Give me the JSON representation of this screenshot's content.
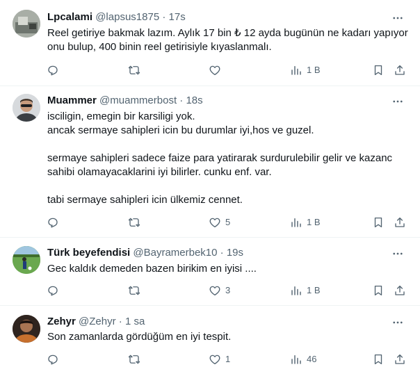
{
  "tweets": [
    {
      "name": "Lpcalami",
      "handle": "@lapsus1875",
      "dot": "·",
      "time": "17s",
      "lines": [
        "Reel getiriye bakmak lazım. Aylık 17 bin ₺ 12 ayda bugünün ne kadarı yapıyor",
        "onu bulup, 400 binin reel getirisiyle kıyaslanmalı."
      ],
      "reply_count": "",
      "retweet_count": "",
      "like_count": "",
      "view_count": "1 B"
    },
    {
      "name": "Muammer",
      "handle": "@muammerbost",
      "dot": "·",
      "time": "18s",
      "lines": [
        "isciligin, emegin bir karsiligi yok.",
        "ancak sermaye sahipleri icin bu durumlar iyi,hos ve guzel.",
        "sermaye sahipleri sadece faize para yatirarak surdurulebilir gelir ve kazanc",
        "sahibi olamayacaklarini iyi bilirler. cunku enf. var.",
        "tabi sermaye sahipleri icin ülkemiz cennet."
      ],
      "reply_count": "",
      "retweet_count": "",
      "like_count": "5",
      "view_count": "1 B"
    },
    {
      "name": "Türk beyefendisi",
      "handle": "@Bayramerbek10",
      "dot": "·",
      "time": "19s",
      "lines": [
        "Gec kaldık demeden bazen birikim en iyisi ...."
      ],
      "reply_count": "",
      "retweet_count": "",
      "like_count": "3",
      "view_count": "1 B"
    },
    {
      "name": "Zehyr",
      "handle": "@Zehyr",
      "dot": "·",
      "time": "1 sa",
      "lines": [
        "Son zamanlarda gördüğüm en iyi tespit."
      ],
      "reply_count": "",
      "retweet_count": "",
      "like_count": "1",
      "view_count": "46"
    }
  ],
  "colors": {
    "text": "#0f1419",
    "secondary": "#536471",
    "divider": "#eff3f4"
  },
  "icons": [
    "more-icon",
    "reply-icon",
    "retweet-icon",
    "like-icon",
    "views-icon",
    "bookmark-icon",
    "share-icon"
  ]
}
